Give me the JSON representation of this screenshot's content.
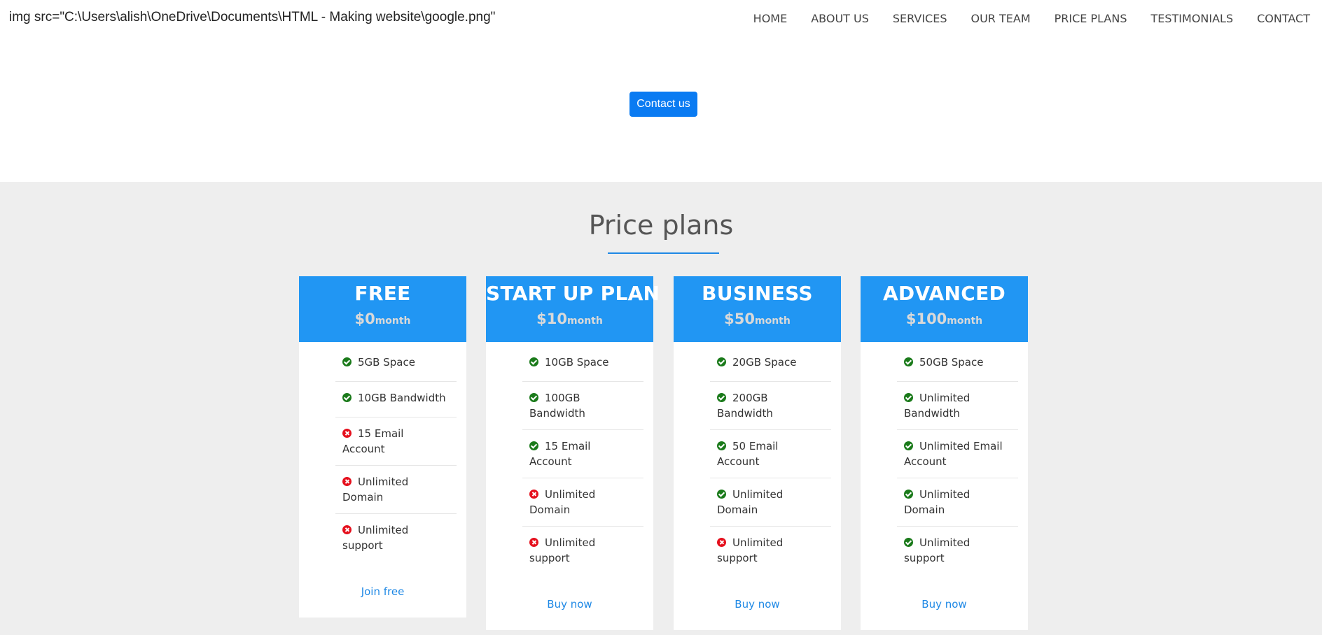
{
  "header": {
    "logo_text": "img src=\"C:\\Users\\alish\\OneDrive\\Documents\\HTML - Making website\\google.png\"",
    "nav": [
      "HOME",
      "ABOUT US",
      "SERVICES",
      "OUR TEAM",
      "PRICE PLANS",
      "TESTIMONIALS",
      "CONTACT"
    ]
  },
  "hero": {
    "contact_label": "Contact us"
  },
  "pricing": {
    "title": "Price plans",
    "plans": [
      {
        "name": "FREE",
        "price": "$0",
        "period": "month",
        "action": "Join free",
        "features": [
          {
            "text": "5GB Space",
            "ok": true
          },
          {
            "text": "10GB Bandwidth",
            "ok": true
          },
          {
            "text": "15 Email Account",
            "ok": false
          },
          {
            "text": "Unlimited Domain",
            "ok": false
          },
          {
            "text": "Unlimited support",
            "ok": false
          }
        ]
      },
      {
        "name": "START UP PLAN",
        "price": "$10",
        "period": "month",
        "action": "Buy now",
        "features": [
          {
            "text": "10GB Space",
            "ok": true
          },
          {
            "text": "100GB Bandwidth",
            "ok": true
          },
          {
            "text": "15 Email Account",
            "ok": true
          },
          {
            "text": "Unlimited Domain",
            "ok": false
          },
          {
            "text": "Unlimited support",
            "ok": false
          }
        ]
      },
      {
        "name": "BUSINESS",
        "price": "$50",
        "period": "month",
        "action": "Buy now",
        "features": [
          {
            "text": "20GB Space",
            "ok": true
          },
          {
            "text": "200GB Bandwidth",
            "ok": true
          },
          {
            "text": "50 Email Account",
            "ok": true
          },
          {
            "text": "Unlimited Domain",
            "ok": true
          },
          {
            "text": "Unlimited support",
            "ok": false
          }
        ]
      },
      {
        "name": "ADVANCED",
        "price": "$100",
        "period": "month",
        "action": "Buy now",
        "features": [
          {
            "text": "50GB Space",
            "ok": true
          },
          {
            "text": "Unlimited Bandwidth",
            "ok": true
          },
          {
            "text": "Unlimited Email Account",
            "ok": true
          },
          {
            "text": "Unlimited Domain",
            "ok": true
          },
          {
            "text": "Unlimited support",
            "ok": true
          }
        ]
      }
    ]
  },
  "colors": {
    "accent": "#2196f3",
    "button": "#0a7bf2",
    "check": "#1a7a1a",
    "cross": "#e5101d",
    "section_bg": "#eeeeee"
  },
  "icons": {
    "included": "check-circle-icon",
    "excluded": "x-circle-icon"
  }
}
